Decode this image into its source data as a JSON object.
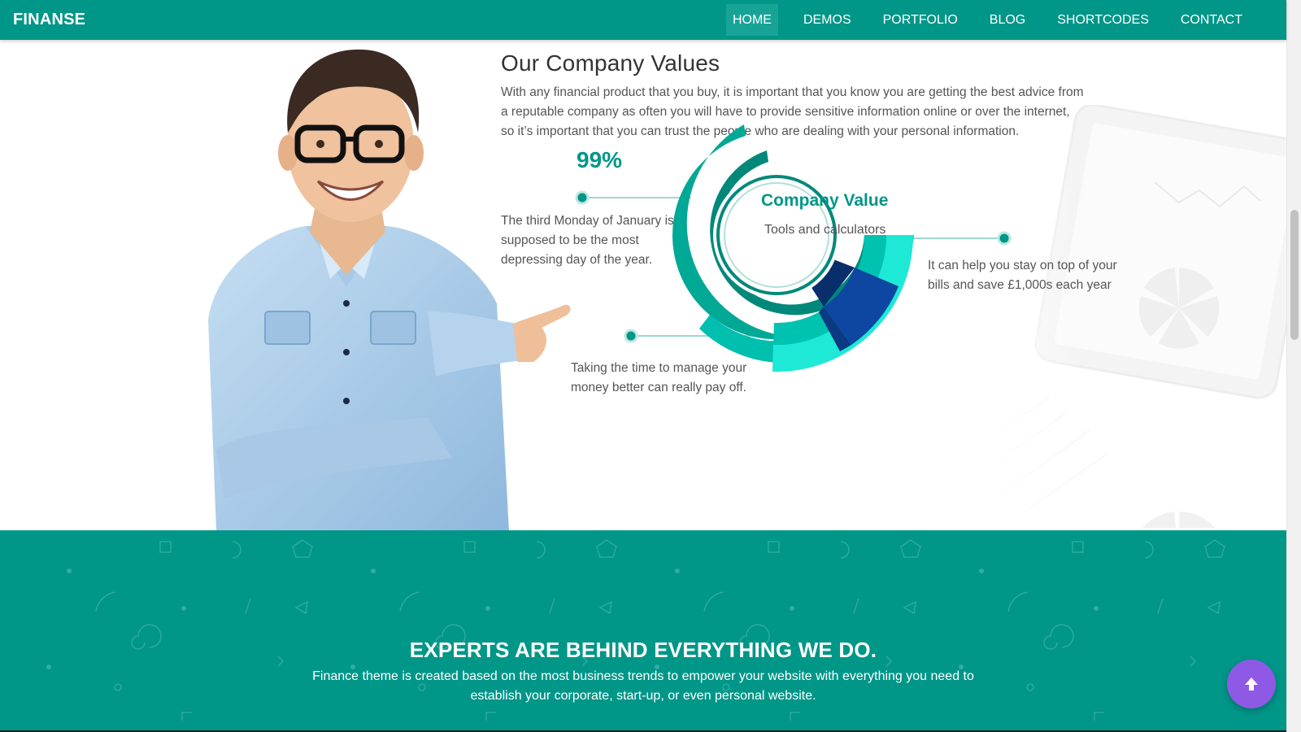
{
  "navbar": {
    "brand": "FINANSE",
    "items": [
      {
        "label": "HOME",
        "active": true
      },
      {
        "label": "DEMOS",
        "active": false
      },
      {
        "label": "PORTFOLIO",
        "active": false
      },
      {
        "label": "BLOG",
        "active": false
      },
      {
        "label": "SHORTCODES",
        "active": false
      },
      {
        "label": "CONTACT",
        "active": false
      }
    ]
  },
  "values": {
    "title": "Our Company Values",
    "description": "With any financial product that you buy, it is important that you know you are getting the best advice from a reputable company as often you will have to provide sensitive information online or over the internet, so it’s important that you can trust the people who are dealing with your personal information.",
    "percent": "99%",
    "chart": {
      "title": "Company Value",
      "subtitle": "Tools and calculators"
    },
    "stats": [
      {
        "text": "The third Monday of January is supposed to be the most depressing day of the year."
      },
      {
        "text": "It can help you stay on top of your bills and save £1,000s each year"
      },
      {
        "text": "Taking the time to manage your money better can really pay off."
      }
    ]
  },
  "experts": {
    "title": "EXPERTS ARE BEHIND EVERYTHING WE DO.",
    "description": "Finance theme is created based on the most business trends to empower your website with everything you need to establish your corporate, start-up, or even personal website."
  },
  "colors": {
    "primary": "#009688",
    "accent_teal": "#00d4c3",
    "dark_blue": "#0d3a7a",
    "back_to_top": "#8e5ae5"
  },
  "icons": {
    "back_to_top": "arrow-up-icon"
  }
}
